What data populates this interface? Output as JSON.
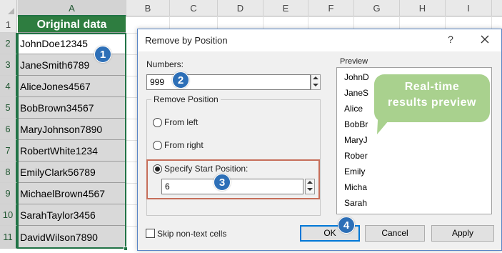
{
  "sheet": {
    "columns": [
      "A",
      "B",
      "C",
      "D",
      "E",
      "F",
      "G",
      "H",
      "I"
    ],
    "rows": [
      "1",
      "2",
      "3",
      "4",
      "5",
      "6",
      "7",
      "8",
      "9",
      "10",
      "11"
    ],
    "header_cell": "Original data",
    "cells": [
      "JohnDoe12345",
      "JaneSmith6789",
      "AliceJones4567",
      "BobBrown34567",
      "MaryJohnson7890",
      "RobertWhite1234",
      "EmilyClark56789",
      "MichaelBrown4567",
      "SarahTaylor3456",
      "DavidWilson7890"
    ],
    "header_color": "#2e7d40",
    "selection_color": "#217346"
  },
  "dialog": {
    "title": "Remove by Position",
    "help": "?",
    "numbers_label": "Numbers:",
    "numbers_value": "999",
    "remove_position_label": "Remove Position",
    "from_left_label": "From left",
    "from_right_label": "From right",
    "specify_label": "Specify Start Position:",
    "specify_value": "6",
    "selected_option": "Specify Start Position:",
    "preview_label": "Preview",
    "preview_items": [
      "JohnD",
      "JaneS",
      "Alice",
      "BobBr",
      "MaryJ",
      "Rober",
      "Emily",
      "Micha",
      "Sarah"
    ],
    "skip_label": "Skip non-text cells",
    "skip_checked": false,
    "ok_label": "OK",
    "cancel_label": "Cancel",
    "apply_label": "Apply"
  },
  "callouts": {
    "badges": [
      "1",
      "2",
      "3",
      "4"
    ],
    "bubble_text_line1": "Real-time",
    "bubble_text_line2": "results preview",
    "badge_color": "#2d6fb7",
    "bubble_color": "#a9d18e"
  }
}
